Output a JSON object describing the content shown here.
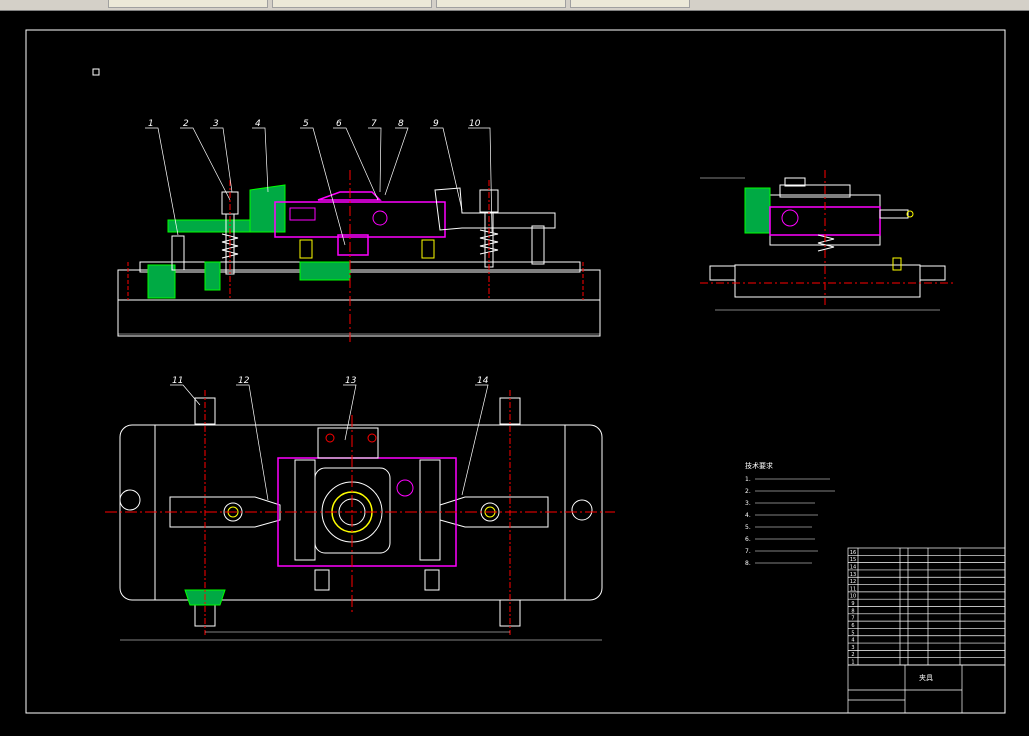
{
  "toolbar": {
    "tabs": [
      "",
      "",
      "",
      "",
      ""
    ]
  },
  "drawing": {
    "callouts_front": [
      "1",
      "2",
      "3",
      "4",
      "5",
      "6",
      "7",
      "8",
      "9",
      "10"
    ],
    "callouts_plan": [
      "11",
      "12",
      "13",
      "14"
    ],
    "tech_title": "技术要求",
    "tech_notes": [
      "1.",
      "2.",
      "3.",
      "4.",
      "5.",
      "6.",
      "7.",
      "8."
    ],
    "title_block": {
      "name": "夹具",
      "drawing_no": "",
      "bom_numbers": [
        "16",
        "15",
        "14",
        "13",
        "12",
        "11",
        "10",
        "9",
        "8",
        "7",
        "6",
        "5",
        "4",
        "3",
        "2",
        "1"
      ]
    }
  },
  "colors": {
    "outline": "#ffffff",
    "section": "#00ff00",
    "workpiece": "#ff00ff",
    "center": "#ff0000",
    "bolt": "#ffff00"
  }
}
